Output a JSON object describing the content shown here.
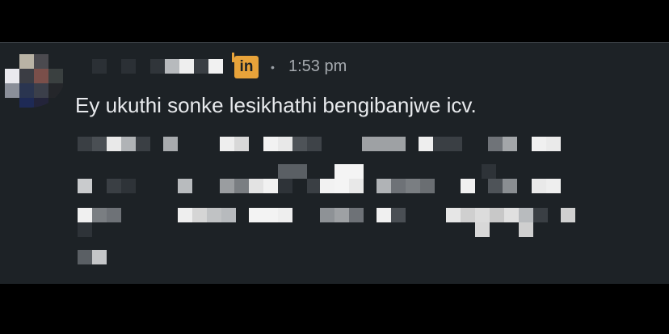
{
  "post": {
    "avatar_alt": "avatar",
    "author_badge_icon": "linkedin-icon",
    "author_badge_text": "in",
    "separator": "•",
    "timestamp": "1:53 pm",
    "message": "Ey ukuthi sonke lesikhathi bengibanjwe icv.",
    "colors": {
      "card_bg": "#1d2226",
      "text": "#e8eaed",
      "muted": "#a6abb0",
      "badge": "#e8a33a"
    }
  }
}
